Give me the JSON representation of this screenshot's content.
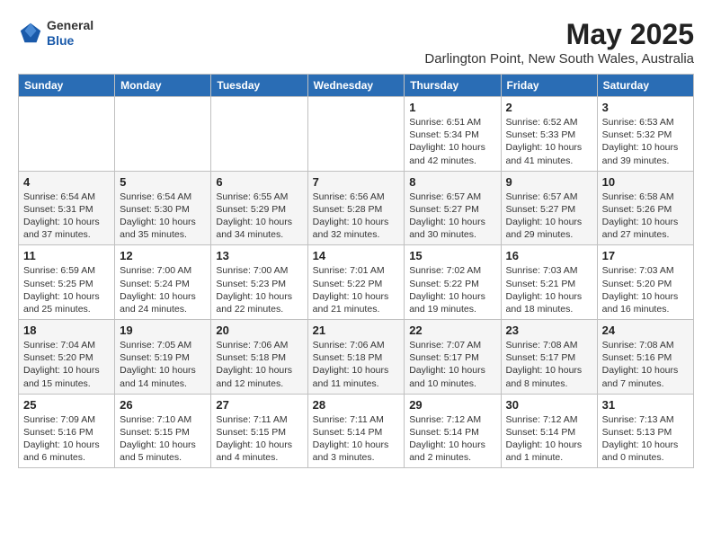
{
  "header": {
    "logo_line1": "General",
    "logo_line2": "Blue",
    "month_year": "May 2025",
    "location": "Darlington Point, New South Wales, Australia"
  },
  "days_of_week": [
    "Sunday",
    "Monday",
    "Tuesday",
    "Wednesday",
    "Thursday",
    "Friday",
    "Saturday"
  ],
  "weeks": [
    [
      {
        "day": "",
        "info": ""
      },
      {
        "day": "",
        "info": ""
      },
      {
        "day": "",
        "info": ""
      },
      {
        "day": "",
        "info": ""
      },
      {
        "day": "1",
        "info": "Sunrise: 6:51 AM\nSunset: 5:34 PM\nDaylight: 10 hours\nand 42 minutes."
      },
      {
        "day": "2",
        "info": "Sunrise: 6:52 AM\nSunset: 5:33 PM\nDaylight: 10 hours\nand 41 minutes."
      },
      {
        "day": "3",
        "info": "Sunrise: 6:53 AM\nSunset: 5:32 PM\nDaylight: 10 hours\nand 39 minutes."
      }
    ],
    [
      {
        "day": "4",
        "info": "Sunrise: 6:54 AM\nSunset: 5:31 PM\nDaylight: 10 hours\nand 37 minutes."
      },
      {
        "day": "5",
        "info": "Sunrise: 6:54 AM\nSunset: 5:30 PM\nDaylight: 10 hours\nand 35 minutes."
      },
      {
        "day": "6",
        "info": "Sunrise: 6:55 AM\nSunset: 5:29 PM\nDaylight: 10 hours\nand 34 minutes."
      },
      {
        "day": "7",
        "info": "Sunrise: 6:56 AM\nSunset: 5:28 PM\nDaylight: 10 hours\nand 32 minutes."
      },
      {
        "day": "8",
        "info": "Sunrise: 6:57 AM\nSunset: 5:27 PM\nDaylight: 10 hours\nand 30 minutes."
      },
      {
        "day": "9",
        "info": "Sunrise: 6:57 AM\nSunset: 5:27 PM\nDaylight: 10 hours\nand 29 minutes."
      },
      {
        "day": "10",
        "info": "Sunrise: 6:58 AM\nSunset: 5:26 PM\nDaylight: 10 hours\nand 27 minutes."
      }
    ],
    [
      {
        "day": "11",
        "info": "Sunrise: 6:59 AM\nSunset: 5:25 PM\nDaylight: 10 hours\nand 25 minutes."
      },
      {
        "day": "12",
        "info": "Sunrise: 7:00 AM\nSunset: 5:24 PM\nDaylight: 10 hours\nand 24 minutes."
      },
      {
        "day": "13",
        "info": "Sunrise: 7:00 AM\nSunset: 5:23 PM\nDaylight: 10 hours\nand 22 minutes."
      },
      {
        "day": "14",
        "info": "Sunrise: 7:01 AM\nSunset: 5:22 PM\nDaylight: 10 hours\nand 21 minutes."
      },
      {
        "day": "15",
        "info": "Sunrise: 7:02 AM\nSunset: 5:22 PM\nDaylight: 10 hours\nand 19 minutes."
      },
      {
        "day": "16",
        "info": "Sunrise: 7:03 AM\nSunset: 5:21 PM\nDaylight: 10 hours\nand 18 minutes."
      },
      {
        "day": "17",
        "info": "Sunrise: 7:03 AM\nSunset: 5:20 PM\nDaylight: 10 hours\nand 16 minutes."
      }
    ],
    [
      {
        "day": "18",
        "info": "Sunrise: 7:04 AM\nSunset: 5:20 PM\nDaylight: 10 hours\nand 15 minutes."
      },
      {
        "day": "19",
        "info": "Sunrise: 7:05 AM\nSunset: 5:19 PM\nDaylight: 10 hours\nand 14 minutes."
      },
      {
        "day": "20",
        "info": "Sunrise: 7:06 AM\nSunset: 5:18 PM\nDaylight: 10 hours\nand 12 minutes."
      },
      {
        "day": "21",
        "info": "Sunrise: 7:06 AM\nSunset: 5:18 PM\nDaylight: 10 hours\nand 11 minutes."
      },
      {
        "day": "22",
        "info": "Sunrise: 7:07 AM\nSunset: 5:17 PM\nDaylight: 10 hours\nand 10 minutes."
      },
      {
        "day": "23",
        "info": "Sunrise: 7:08 AM\nSunset: 5:17 PM\nDaylight: 10 hours\nand 8 minutes."
      },
      {
        "day": "24",
        "info": "Sunrise: 7:08 AM\nSunset: 5:16 PM\nDaylight: 10 hours\nand 7 minutes."
      }
    ],
    [
      {
        "day": "25",
        "info": "Sunrise: 7:09 AM\nSunset: 5:16 PM\nDaylight: 10 hours\nand 6 minutes."
      },
      {
        "day": "26",
        "info": "Sunrise: 7:10 AM\nSunset: 5:15 PM\nDaylight: 10 hours\nand 5 minutes."
      },
      {
        "day": "27",
        "info": "Sunrise: 7:11 AM\nSunset: 5:15 PM\nDaylight: 10 hours\nand 4 minutes."
      },
      {
        "day": "28",
        "info": "Sunrise: 7:11 AM\nSunset: 5:14 PM\nDaylight: 10 hours\nand 3 minutes."
      },
      {
        "day": "29",
        "info": "Sunrise: 7:12 AM\nSunset: 5:14 PM\nDaylight: 10 hours\nand 2 minutes."
      },
      {
        "day": "30",
        "info": "Sunrise: 7:12 AM\nSunset: 5:14 PM\nDaylight: 10 hours\nand 1 minute."
      },
      {
        "day": "31",
        "info": "Sunrise: 7:13 AM\nSunset: 5:13 PM\nDaylight: 10 hours\nand 0 minutes."
      }
    ]
  ]
}
